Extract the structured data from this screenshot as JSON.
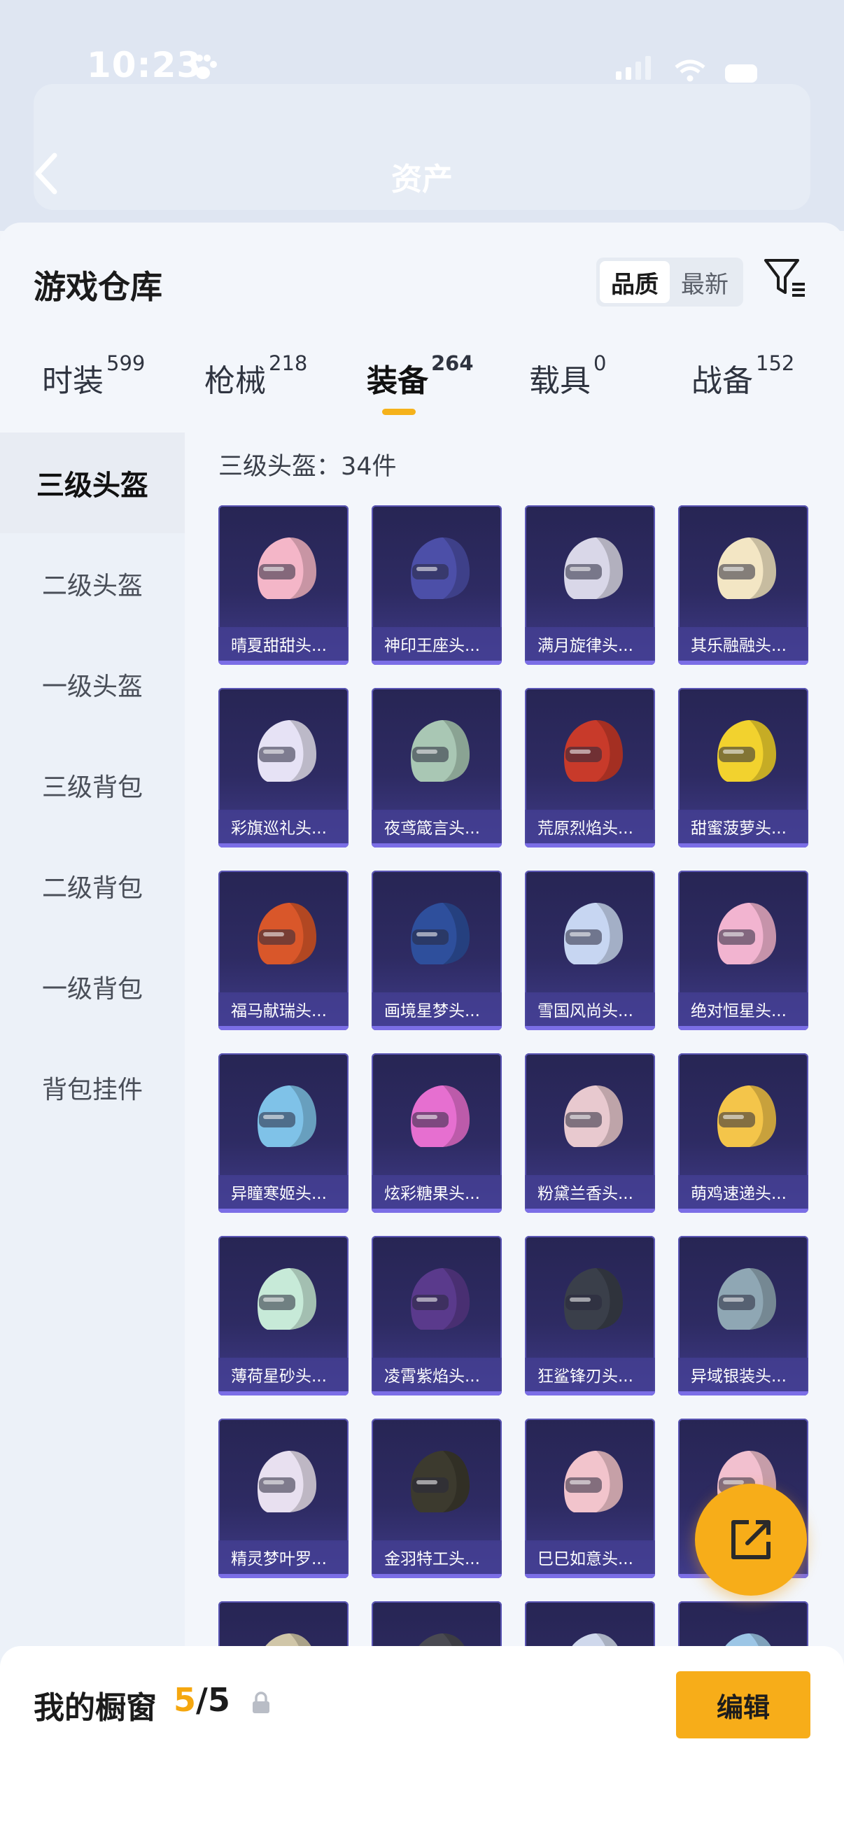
{
  "status": {
    "time": "10:23"
  },
  "header": {
    "title": "资产"
  },
  "sheet": {
    "title": "游戏仓库",
    "sort": [
      {
        "label": "品质",
        "active": true
      },
      {
        "label": "最新",
        "active": false
      }
    ]
  },
  "tabs": [
    {
      "label": "时装",
      "count": "599"
    },
    {
      "label": "枪械",
      "count": "218"
    },
    {
      "label": "装备",
      "count": "264",
      "active": true
    },
    {
      "label": "载具",
      "count": "0"
    },
    {
      "label": "战备",
      "count": "152"
    }
  ],
  "sidebar": {
    "items": [
      {
        "label": "三级头盔",
        "active": true
      },
      {
        "label": "二级头盔"
      },
      {
        "label": "一级头盔"
      },
      {
        "label": "三级背包"
      },
      {
        "label": "二级背包"
      },
      {
        "label": "一级背包"
      },
      {
        "label": "背包挂件"
      }
    ]
  },
  "content": {
    "count_label": "三级头盔：34件",
    "items": [
      {
        "name": "晴夏甜甜头...",
        "color": "#f4b6c8"
      },
      {
        "name": "神印王座头...",
        "color": "#4c4fa8"
      },
      {
        "name": "满月旋律头...",
        "color": "#d9d7e8"
      },
      {
        "name": "其乐融融头...",
        "color": "#f3e6c4"
      },
      {
        "name": "彩旗巡礼头...",
        "color": "#e6e2f5"
      },
      {
        "name": "夜鸢箴言头...",
        "color": "#a9c7b4"
      },
      {
        "name": "荒原烈焰头...",
        "color": "#c83a2a"
      },
      {
        "name": "甜蜜菠萝头...",
        "color": "#f2d22e"
      },
      {
        "name": "福马献瑞头...",
        "color": "#d9572a"
      },
      {
        "name": "画境星梦头...",
        "color": "#2e4f9c"
      },
      {
        "name": "雪国风尚头...",
        "color": "#c7d6f2"
      },
      {
        "name": "绝对恒星头...",
        "color": "#f2b4d0"
      },
      {
        "name": "异瞳寒姬头...",
        "color": "#7fc2e8"
      },
      {
        "name": "炫彩糖果头...",
        "color": "#e66fd0"
      },
      {
        "name": "粉黛兰香头...",
        "color": "#e8c9cf"
      },
      {
        "name": "萌鸡速递头...",
        "color": "#f4c54a"
      },
      {
        "name": "薄荷星砂头...",
        "color": "#c7ead8"
      },
      {
        "name": "凌霄紫焰头...",
        "color": "#5a3a8c"
      },
      {
        "name": "狂鲨锋刃头...",
        "color": "#3a3f4a"
      },
      {
        "name": "异域银装头...",
        "color": "#8fa7b4"
      },
      {
        "name": "精灵梦叶罗...",
        "color": "#e8e0f0"
      },
      {
        "name": "金羽特工头...",
        "color": "#3c3a2e"
      },
      {
        "name": "巳巳如意头...",
        "color": "#f2c4cc"
      },
      {
        "name": "",
        "color": "#f2c0cf"
      },
      {
        "name": "",
        "color": "#d0c6a8"
      },
      {
        "name": "",
        "color": "#4a4a52"
      },
      {
        "name": "",
        "color": "#cfd8ec"
      },
      {
        "name": "",
        "color": "#9cc6e6"
      }
    ]
  },
  "bottom": {
    "showcase_label": "我的橱窗",
    "showcase_current": "5",
    "showcase_separator": "/",
    "showcase_total": "5",
    "edit_label": "编辑"
  },
  "colors": {
    "accent": "#f7ad19",
    "card_bg": "#2a2860"
  }
}
